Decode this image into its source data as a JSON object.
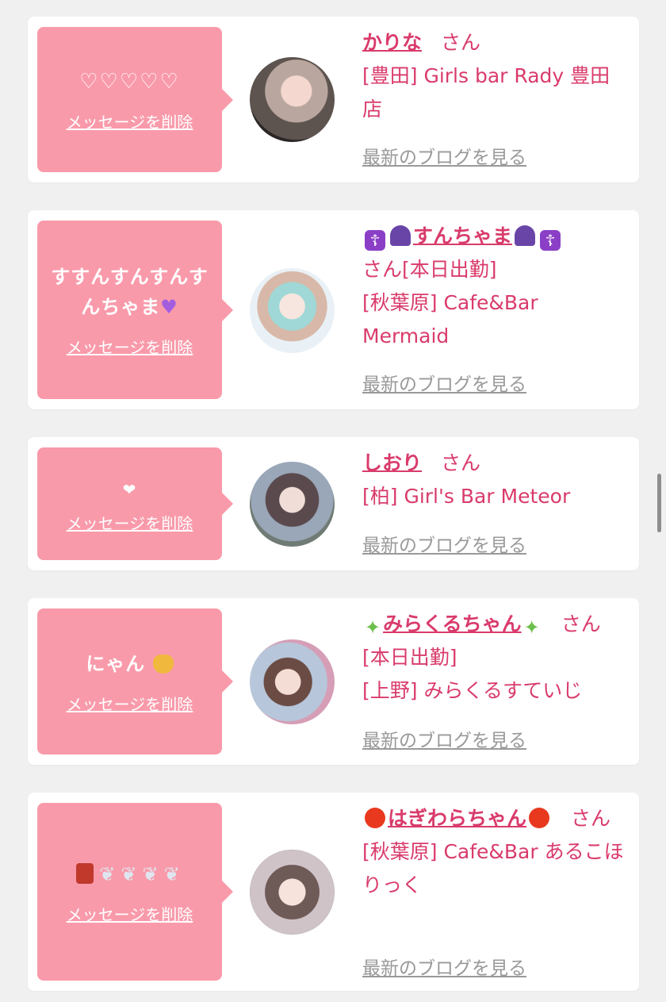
{
  "delete_label": "メッセージを削除",
  "blog_label": "最新のブログを見る",
  "san_label": "さん",
  "entries": [
    {
      "message": "♡♡♡♡♡",
      "name": "かりな",
      "status": "",
      "shop": "[豊田] Girls bar Rady 豊田店"
    },
    {
      "message": "すすんすんすんすんちゃま",
      "name": "すんちゃま",
      "status": "[本日出勤]",
      "shop": "[秋葉原] Cafe&Bar Mermaid"
    },
    {
      "message": "❤",
      "name": "しおり",
      "status": "",
      "shop": "[柏] Girl's Bar Meteor"
    },
    {
      "message": "にゃん",
      "name": "みらくるちゃん",
      "status": "[本日出勤]",
      "shop": "[上野] みらくるすていじ"
    },
    {
      "message": "",
      "name": "はぎわらちゃん",
      "status": "",
      "shop": "[秋葉原] Cafe&Bar あるこほりっく"
    }
  ],
  "colors": {
    "accent": "#d93b6b",
    "bubble": "#f99aaa",
    "link_gray": "#999999",
    "background": "#f0f0f0"
  }
}
